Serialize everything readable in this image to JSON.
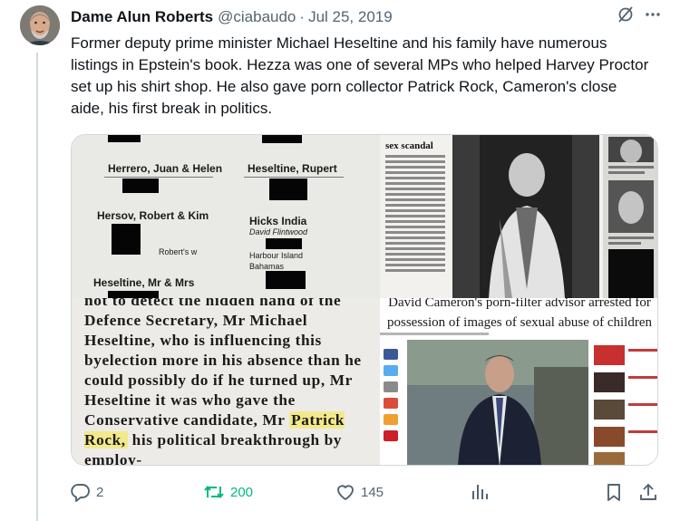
{
  "tweet": {
    "display_name": "Dame Alun Roberts",
    "handle": "@ciabaudo",
    "separator": "·",
    "date": "Jul 25, 2019",
    "text": "Former deputy prime minister Michael Heseltine and his family have numerous listings in Epstein's book. Hezza was one of several MPs who helped Harvey Proctor set up his shirt shop. He also gave porn collector Patrick Rock, Cameron's close aide, his first break in politics."
  },
  "header_icons": [
    "grok-icon",
    "more-icon"
  ],
  "media": {
    "address_book": {
      "entries": [
        "Herrero, Juan & Helen",
        "Heseltine, Rupert",
        "Hersov, Robert & Kim",
        "Hicks India",
        "Heseltine, Mr & Mrs"
      ],
      "fragments": [
        "Robert's w",
        "David Flintwood",
        "Harbour Island",
        "Bahamas"
      ]
    },
    "newspaper": {
      "heading": "sex scandal"
    },
    "clipping": {
      "text_before": "not to detect the hidden hand of the Defence Secretary, Mr Michael Heseltine, who is influencing this byelection more in his absence than he could possibly do if he turned up, Mr Heseltine it was who gave the Conservative candidate, Mr ",
      "highlight": "Patrick Rock,",
      "text_after": " his political breakthrough by employ-"
    },
    "web_article": {
      "headline_top": "David Cameron's porn-filter advisor arrested for",
      "headline": "possession of images of sexual abuse of children"
    }
  },
  "actions": {
    "replies": "2",
    "retweets": "200",
    "likes": "145"
  },
  "colors": {
    "text": "#0f1419",
    "secondary": "#536471",
    "retweet_green": "#00ba7c",
    "border": "#cfd9de"
  }
}
